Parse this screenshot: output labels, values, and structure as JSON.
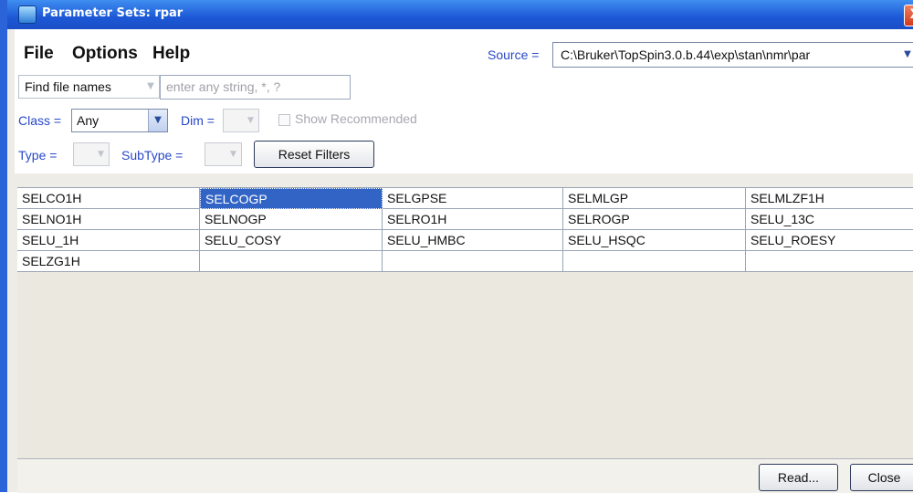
{
  "window": {
    "title": "Parameter Sets: rpar",
    "close_glyph": "X"
  },
  "menu": {
    "items": [
      "File",
      "Options",
      "Help"
    ]
  },
  "source": {
    "label": "Source =",
    "value": "C:\\Bruker\\TopSpin3.0.b.44\\exp\\stan\\nmr\\par"
  },
  "filters": {
    "find_mode": "Find file names",
    "find_placeholder": "enter any string, *, ?",
    "class_label": "Class =",
    "class_value": "Any",
    "dim_label": "Dim =",
    "show_recommended_label": "Show Recommended",
    "show_recommended_checked": false,
    "type_label": "Type =",
    "subtype_label": "SubType =",
    "reset_label": "Reset Filters"
  },
  "table": {
    "rows": [
      [
        "SELCO1H",
        "SELCOGP",
        "SELGPSE",
        "SELMLGP",
        "SELMLZF1H"
      ],
      [
        "SELNO1H",
        "SELNOGP",
        "SELRO1H",
        "SELROGP",
        "SELU_13C"
      ],
      [
        "SELU_1H",
        "SELU_COSY",
        "SELU_HMBC",
        "SELU_HSQC",
        "SELU_ROESY"
      ],
      [
        "SELZG1H",
        "",
        "",
        "",
        ""
      ]
    ],
    "selected": "SELCOGP"
  },
  "buttons": {
    "read": "Read...",
    "close": "Close"
  },
  "icons": {
    "window_icon": "topspin-app-icon",
    "dropdown": "chevron-down-icon",
    "close": "close-icon"
  },
  "colors": {
    "titlebar": "#1d58d6",
    "label_blue": "#2848c8",
    "selection": "#3264c6"
  }
}
